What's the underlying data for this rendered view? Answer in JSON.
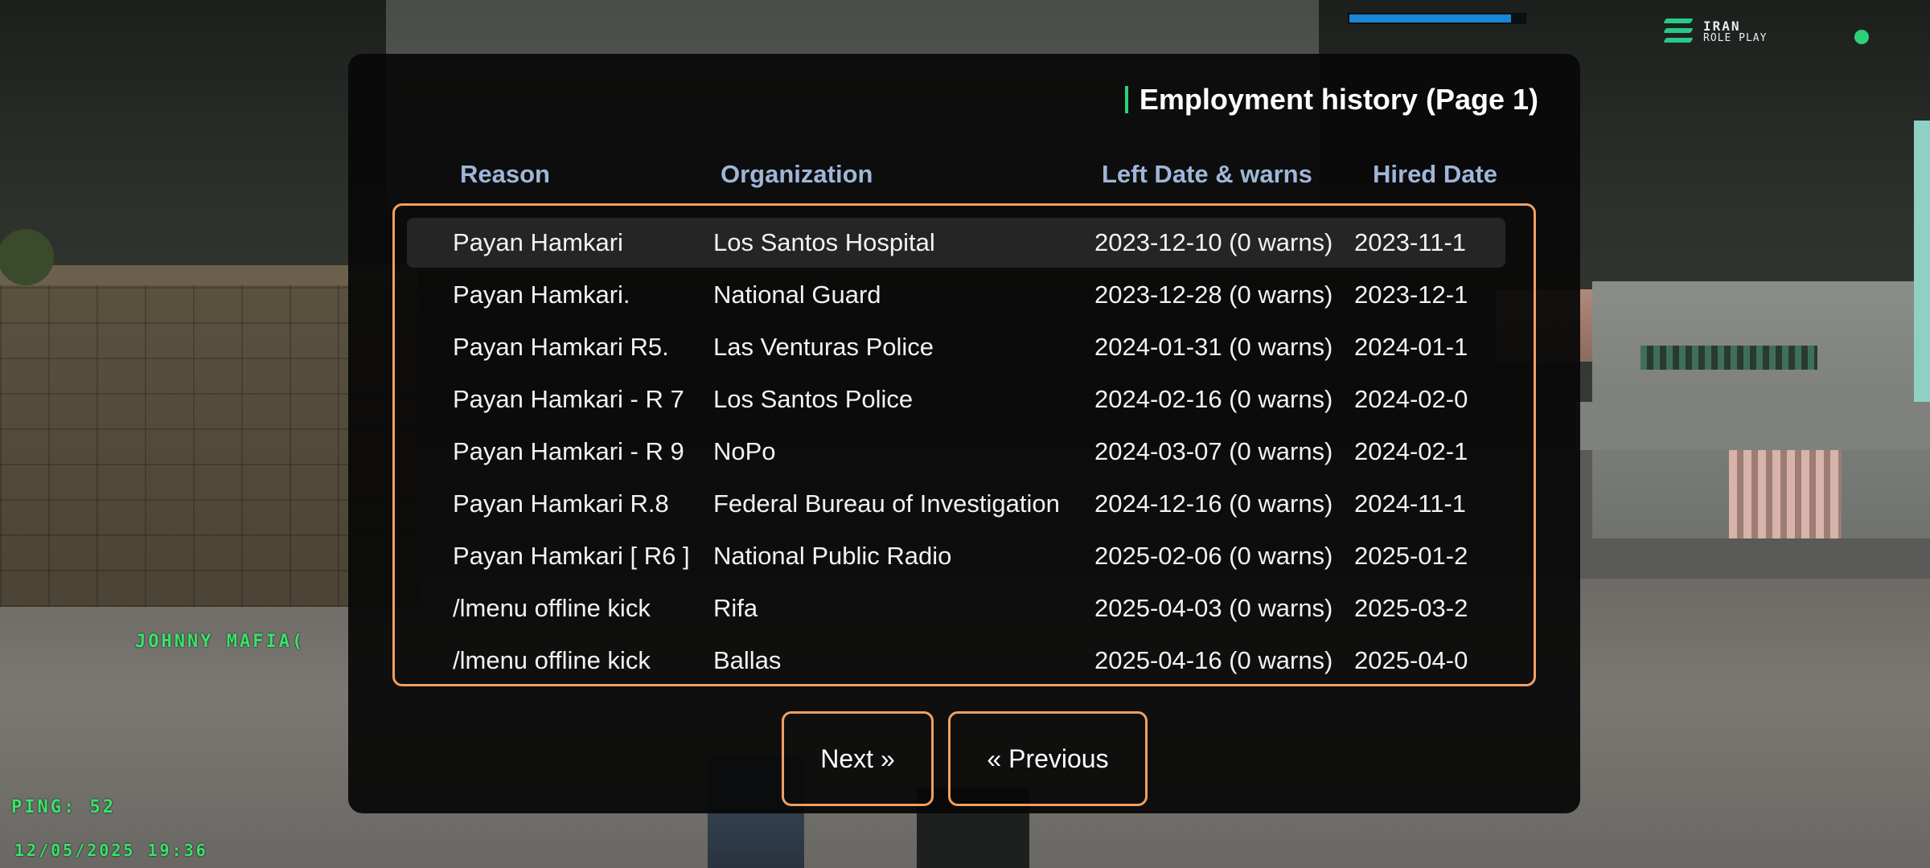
{
  "hud": {
    "progress_fraction": 0.92,
    "logo_line1": "IRAN",
    "logo_line2": "ROLE PLAY",
    "player_label": "JOHNNY MAFIA(",
    "ping": "PING: 52",
    "datetime": "12/05/2025 19:36",
    "colors": {
      "hud_text": "#39e36a",
      "progress": "#1a86d6",
      "status_dot": "#2ecf7a"
    }
  },
  "dialog": {
    "title": "Employment history (Page 1)",
    "columns": {
      "reason": "Reason",
      "organization": "Organization",
      "left_date": "Left Date & warns",
      "hired_date": "Hired Date"
    },
    "rows": [
      {
        "reason": "Payan Hamkari",
        "organization": "Los Santos Hospital",
        "left": "2023-12-10 (0 warns)",
        "hired": "2023-11-1",
        "selected": true
      },
      {
        "reason": "Payan Hamkari.",
        "organization": "National Guard",
        "left": "2023-12-28 (0 warns)",
        "hired": "2023-12-1"
      },
      {
        "reason": "Payan Hamkari R5.",
        "organization": "Las Venturas Police",
        "left": "2024-01-31 (0 warns)",
        "hired": "2024-01-1"
      },
      {
        "reason": "Payan Hamkari - R 7",
        "organization": "Los Santos Police",
        "left": "2024-02-16 (0 warns)",
        "hired": "2024-02-0"
      },
      {
        "reason": "Payan Hamkari - R 9",
        "organization": "NoPo",
        "left": "2024-03-07 (0 warns)",
        "hired": "2024-02-1"
      },
      {
        "reason": "Payan Hamkari R.8",
        "organization": "Federal Bureau of Investigation",
        "left": "2024-12-16 (0 warns)",
        "hired": "2024-11-1"
      },
      {
        "reason": "Payan Hamkari [ R6 ]",
        "organization": "National Public Radio",
        "left": "2025-02-06 (0 warns)",
        "hired": "2025-01-2"
      },
      {
        "reason": "/lmenu offline kick",
        "organization": "Rifa",
        "left": "2025-04-03 (0 warns)",
        "hired": "2025-03-2"
      },
      {
        "reason": "/lmenu offline kick",
        "organization": "Ballas",
        "left": "2025-04-16 (0 warns)",
        "hired": "2025-04-0"
      }
    ],
    "buttons": {
      "next": "Next »",
      "previous": "« Previous"
    },
    "colors": {
      "accent": "#f0a062",
      "header_text": "#9fb6d8",
      "title_bar": "#2ecf7a"
    }
  }
}
